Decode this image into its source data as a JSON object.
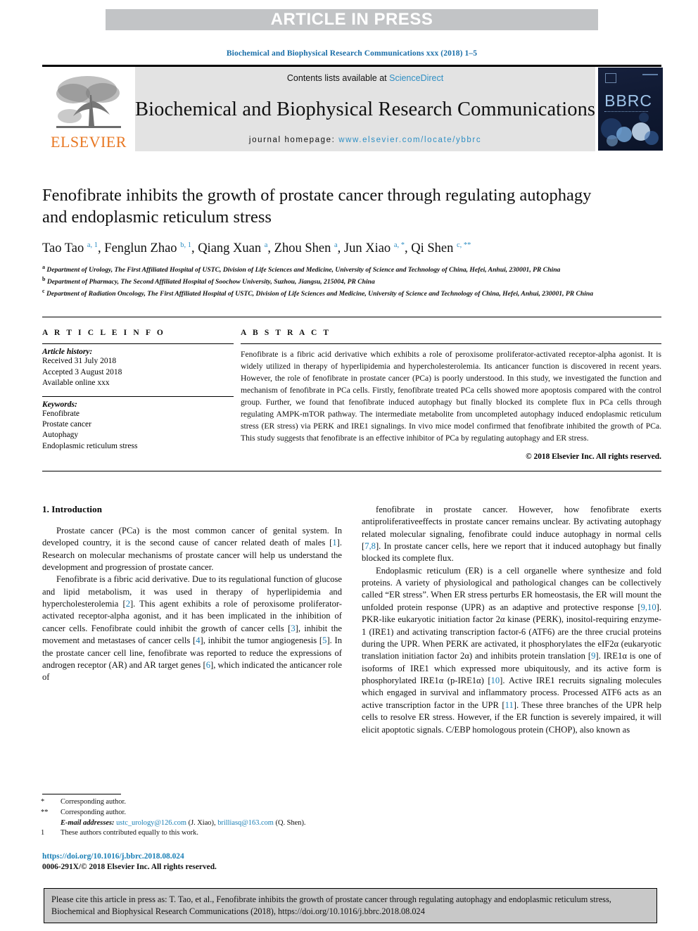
{
  "banner": {
    "label": "ARTICLE IN PRESS"
  },
  "running_head": "Biochemical and Biophysical Research Communications xxx (2018) 1–5",
  "masthead": {
    "publisher": "ELSEVIER",
    "contents_prefix": "Contents lists available at ",
    "contents_link": "ScienceDirect",
    "journal_title": "Biochemical and Biophysical Research Communications",
    "homepage_prefix": "journal homepage: ",
    "homepage_url": "www.elsevier.com/locate/ybbrc",
    "cover_label": "BBRC"
  },
  "article": {
    "title": "Fenofibrate inhibits the growth of prostate cancer through regulating autophagy and endoplasmic reticulum stress",
    "authors": [
      {
        "name": "Tao Tao",
        "sup": "a, 1"
      },
      {
        "name": "Fenglun Zhao",
        "sup": "b, 1"
      },
      {
        "name": "Qiang Xuan",
        "sup": "a"
      },
      {
        "name": "Zhou Shen",
        "sup": "a"
      },
      {
        "name": "Jun Xiao",
        "sup": "a, *"
      },
      {
        "name": "Qi Shen",
        "sup": "c, **"
      }
    ],
    "affiliations": [
      {
        "mark": "a",
        "text": "Department of Urology, The First Affiliated Hospital of USTC, Division of Life Sciences and Medicine, University of Science and Technology of China, Hefei, Anhui, 230001, PR China"
      },
      {
        "mark": "b",
        "text": "Department of Pharmacy, The Second Affiliated Hospital of Soochow University, Suzhou, Jiangsu, 215004, PR China"
      },
      {
        "mark": "c",
        "text": "Department of Radiation Oncology, The First Affiliated Hospital of USTC, Division of Life Sciences and Medicine, University of Science and Technology of China, Hefei, Anhui, 230001, PR China"
      }
    ]
  },
  "article_info": {
    "heading": "A R T I C L E   I N F O",
    "history_label": "Article history:",
    "history": [
      "Received 31 July 2018",
      "Accepted 3 August 2018",
      "Available online xxx"
    ],
    "keywords_label": "Keywords:",
    "keywords": [
      "Fenofibrate",
      "Prostate cancer",
      "Autophagy",
      "Endoplasmic reticulum stress"
    ]
  },
  "abstract": {
    "heading": "A B S T R A C T",
    "text": "Fenofibrate is a fibric acid derivative which exhibits a role of peroxisome proliferator-activated receptor-alpha agonist. It is widely utilized in therapy of hyperlipidemia and hypercholesterolemia. Its anticancer function is discovered in recent years. However, the role of fenofibrate in prostate cancer (PCa) is poorly understood. In this study, we investigated the function and mechanism of fenofibrate in PCa cells. Firstly, fenofibrate treated PCa cells showed more apoptosis compared with the control group. Further, we found that fenofibrate induced autophagy but finally blocked its complete flux in PCa cells through regulating AMPK-mTOR pathway. The intermediate metabolite from uncompleted autophagy induced endoplasmic reticulum stress (ER stress) via PERK and IRE1 signalings. In vivo mice model confirmed that fenofibrate inhibited the growth of PCa. This study suggests that fenofibrate is an effective inhibitor of PCa by regulating autophagy and ER stress.",
    "copyright": "© 2018 Elsevier Inc. All rights reserved."
  },
  "introduction": {
    "section_number_title": "1. Introduction",
    "left_paragraphs": [
      {
        "id": "p1",
        "parts": [
          {
            "t": "Prostate cancer (PCa) is the most common cancer of genital system. In developed country, it is the second cause of cancer related death of males ["
          },
          {
            "t": "1",
            "ref": true
          },
          {
            "t": "]. Research on molecular mechanisms of prostate cancer will help us understand the development and progression of prostate cancer."
          }
        ]
      },
      {
        "id": "p2",
        "parts": [
          {
            "t": "Fenofibrate is a fibric acid derivative. Due to its regulational function of glucose and lipid metabolism, it was used in therapy of hyperlipidemia and hypercholesterolemia ["
          },
          {
            "t": "2",
            "ref": true
          },
          {
            "t": "]. This agent exhibits a role of peroxisome proliferator-activated receptor-alpha agonist, and it has been implicated in the inhibition of cancer cells. Fenofibrate could inhibit the growth of cancer cells ["
          },
          {
            "t": "3",
            "ref": true
          },
          {
            "t": "], inhibit the movement and metastases of cancer cells ["
          },
          {
            "t": "4",
            "ref": true
          },
          {
            "t": "], inhibit the tumor angiogenesis ["
          },
          {
            "t": "5",
            "ref": true
          },
          {
            "t": "]. In the prostate cancer cell line, fenofibrate was reported to reduce the expressions of androgen receptor (AR) and AR target genes ["
          },
          {
            "t": "6",
            "ref": true
          },
          {
            "t": "], which indicated the anticancer role of"
          }
        ]
      }
    ],
    "right_paragraphs": [
      {
        "id": "p3",
        "parts": [
          {
            "t": "fenofibrate in prostate cancer. However, how fenofibrate exerts antiproliferativeeffects in prostate cancer remains unclear. By activating autophagy related molecular signaling, fenofibrate could induce autophagy in normal cells ["
          },
          {
            "t": "7,8",
            "ref": true
          },
          {
            "t": "]. In prostate cancer cells, here we report that it induced autophagy but finally blocked its complete flux."
          }
        ]
      },
      {
        "id": "p4",
        "parts": [
          {
            "t": "Endoplasmic reticulum (ER) is a cell organelle where synthesize and fold proteins. A variety of physiological and pathological changes can be collectively called “ER stress”. When ER stress perturbs ER homeostasis, the ER will mount the unfolded protein response (UPR) as an adaptive and protective response ["
          },
          {
            "t": "9,10",
            "ref": true
          },
          {
            "t": "]. PKR-like eukaryotic initiation factor 2α kinase (PERK), inositol-requiring enzyme-1 (IRE1) and activating transcription factor-6 (ATF6) are the three crucial proteins during the UPR. When PERK are activated, it phosphorylates the eIF2α (eukaryotic translation initiation factor 2α) and inhibits protein translation ["
          },
          {
            "t": "9",
            "ref": true
          },
          {
            "t": "]. IRE1α is one of isoforms of IRE1 which expressed more ubiquitously, and its active form is phosphorylated IRE1α (p-IRE1α) ["
          },
          {
            "t": "10",
            "ref": true
          },
          {
            "t": "]. Active IRE1 recruits signaling molecules which engaged in survival and inflammatory process. Processed ATF6 acts as an active transcription factor in the UPR ["
          },
          {
            "t": "11",
            "ref": true
          },
          {
            "t": "]. These three branches of the UPR help cells to resolve ER stress. However, if the ER function is severely impaired, it will elicit apoptotic signals. C/EBP homologous protein (CHOP), also known as"
          }
        ]
      }
    ]
  },
  "footnotes": {
    "corresponding_1_mark": "*",
    "corresponding_1": "Corresponding author.",
    "corresponding_2_mark": "**",
    "corresponding_2": "Corresponding author.",
    "email_label": "E-mail addresses:",
    "email_1": "ustc_urology@126.com",
    "email_1_owner": "(J. Xiao),",
    "email_2": "brilliasq@163.com",
    "email_2_owner": "(Q. Shen).",
    "equal_mark": "1",
    "equal_contrib": "These authors contributed equally to this work.",
    "doi": "https://doi.org/10.1016/j.bbrc.2018.08.024",
    "issn_line": "0006-291X/© 2018 Elsevier Inc. All rights reserved."
  },
  "cite_box": {
    "text": "Please cite this article in press as: T. Tao, et al., Fenofibrate inhibits the growth of prostate cancer through regulating autophagy and endoplasmic reticulum stress, Biochemical and Biophysical Research Communications (2018), https://doi.org/10.1016/j.bbrc.2018.08.024"
  },
  "colors": {
    "link": "#1a7fb5",
    "sciencedirect": "#2f8fc4",
    "elsevier_orange": "#e87722",
    "banner_grey": "#c2c4c6",
    "masthead_grey": "#e3e3e3",
    "cite_box_grey": "#c8c8c8"
  }
}
